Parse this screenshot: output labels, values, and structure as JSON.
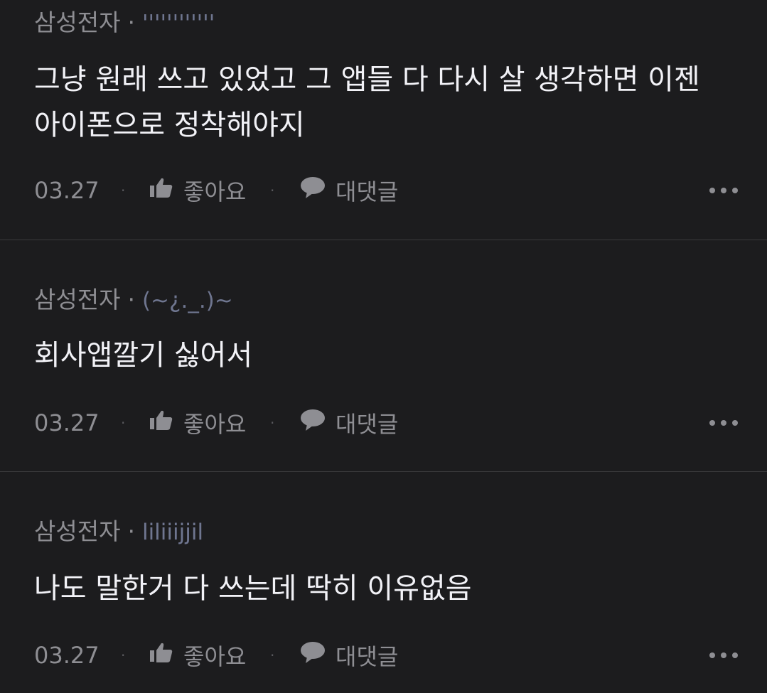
{
  "comments": [
    {
      "company": "삼성전자",
      "separator": "·",
      "nickname": "''''''''''''",
      "text": "그냥 원래 쓰고 있었고 그 앱들 다 다시 살 생각하면 이젠\n아이폰으로 정착해야지",
      "date": "03.27",
      "like_label": "좋아요",
      "reply_label": "대댓글",
      "like_icon": "thumbs-up-icon",
      "reply_icon": "speech-bubble-icon",
      "more_icon": "more-dots-icon"
    },
    {
      "company": "삼성전자",
      "separator": "·",
      "nickname": "(~¿._.)~",
      "text": "회사앱깔기 싫어서",
      "date": "03.27",
      "like_label": "좋아요",
      "reply_label": "대댓글",
      "like_icon": "thumbs-up-icon",
      "reply_icon": "speech-bubble-icon",
      "more_icon": "more-dots-icon"
    },
    {
      "company": "삼성전자",
      "separator": "·",
      "nickname": "liliiijjil",
      "text": "나도 말한거 다 쓰는데 딱히 이유없음",
      "date": "03.27",
      "like_label": "좋아요",
      "reply_label": "대댓글",
      "like_icon": "thumbs-up-icon",
      "reply_icon": "speech-bubble-icon",
      "more_icon": "more-dots-icon"
    }
  ],
  "colors": {
    "background": "#1c1c1e",
    "text": "#f2f2f7",
    "muted": "#8e8e93",
    "nickname": "#6f7690",
    "divider": "#3a3a3c"
  }
}
